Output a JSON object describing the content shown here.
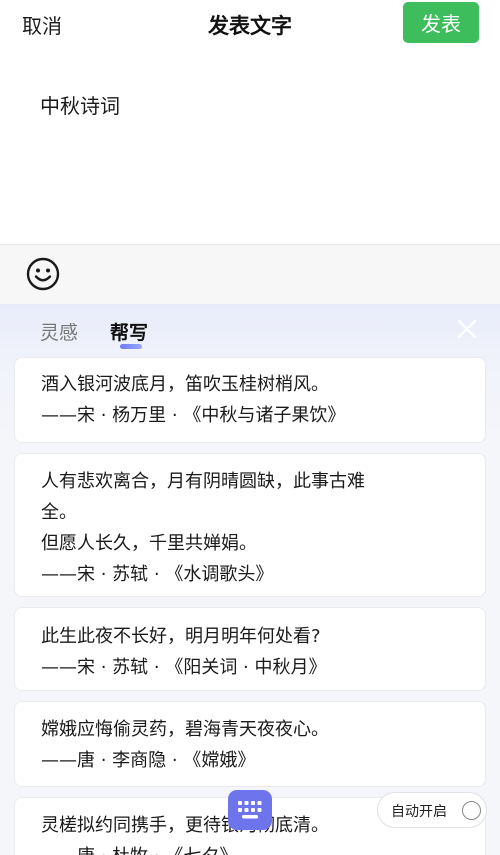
{
  "header": {
    "cancel_label": "取消",
    "title": "发表文字",
    "publish_label": "发表"
  },
  "editor": {
    "text": "中秋诗词"
  },
  "toolbar": {
    "emoji_icon": "emoji-smile-icon"
  },
  "panel": {
    "tabs": [
      {
        "label": "灵感",
        "active": false
      },
      {
        "label": "帮写",
        "active": true
      }
    ],
    "close_icon": "close-icon",
    "poems": [
      {
        "lines": [
          "酒入银河波底月，笛吹玉桂树梢风。",
          "——宋 · 杨万里 · 《中秋与诸子果饮》"
        ]
      },
      {
        "lines": [
          "人有悲欢离合，月有阴晴圆缺，此事古难",
          "全。",
          "但愿人长久，千里共婵娟。",
          "——宋 · 苏轼 · 《水调歌头》"
        ]
      },
      {
        "lines": [
          "此生此夜不长好，明月明年何处看?",
          "——宋 · 苏轼 · 《阳关词 · 中秋月》"
        ]
      },
      {
        "lines": [
          "嫦娥应悔偷灵药，碧海青天夜夜心。",
          "——唐 · 李商隐 · 《嫦娥》"
        ]
      },
      {
        "lines": [
          "灵槎拟约同携手，更待银河彻底清。",
          "——唐 · 杜牧 · 《七夕》"
        ]
      }
    ],
    "keyboard_icon": "keyboard-icon",
    "auto_label": "自动开启",
    "accent_color": "#6e74ec",
    "publish_color": "#3ebd5c"
  }
}
